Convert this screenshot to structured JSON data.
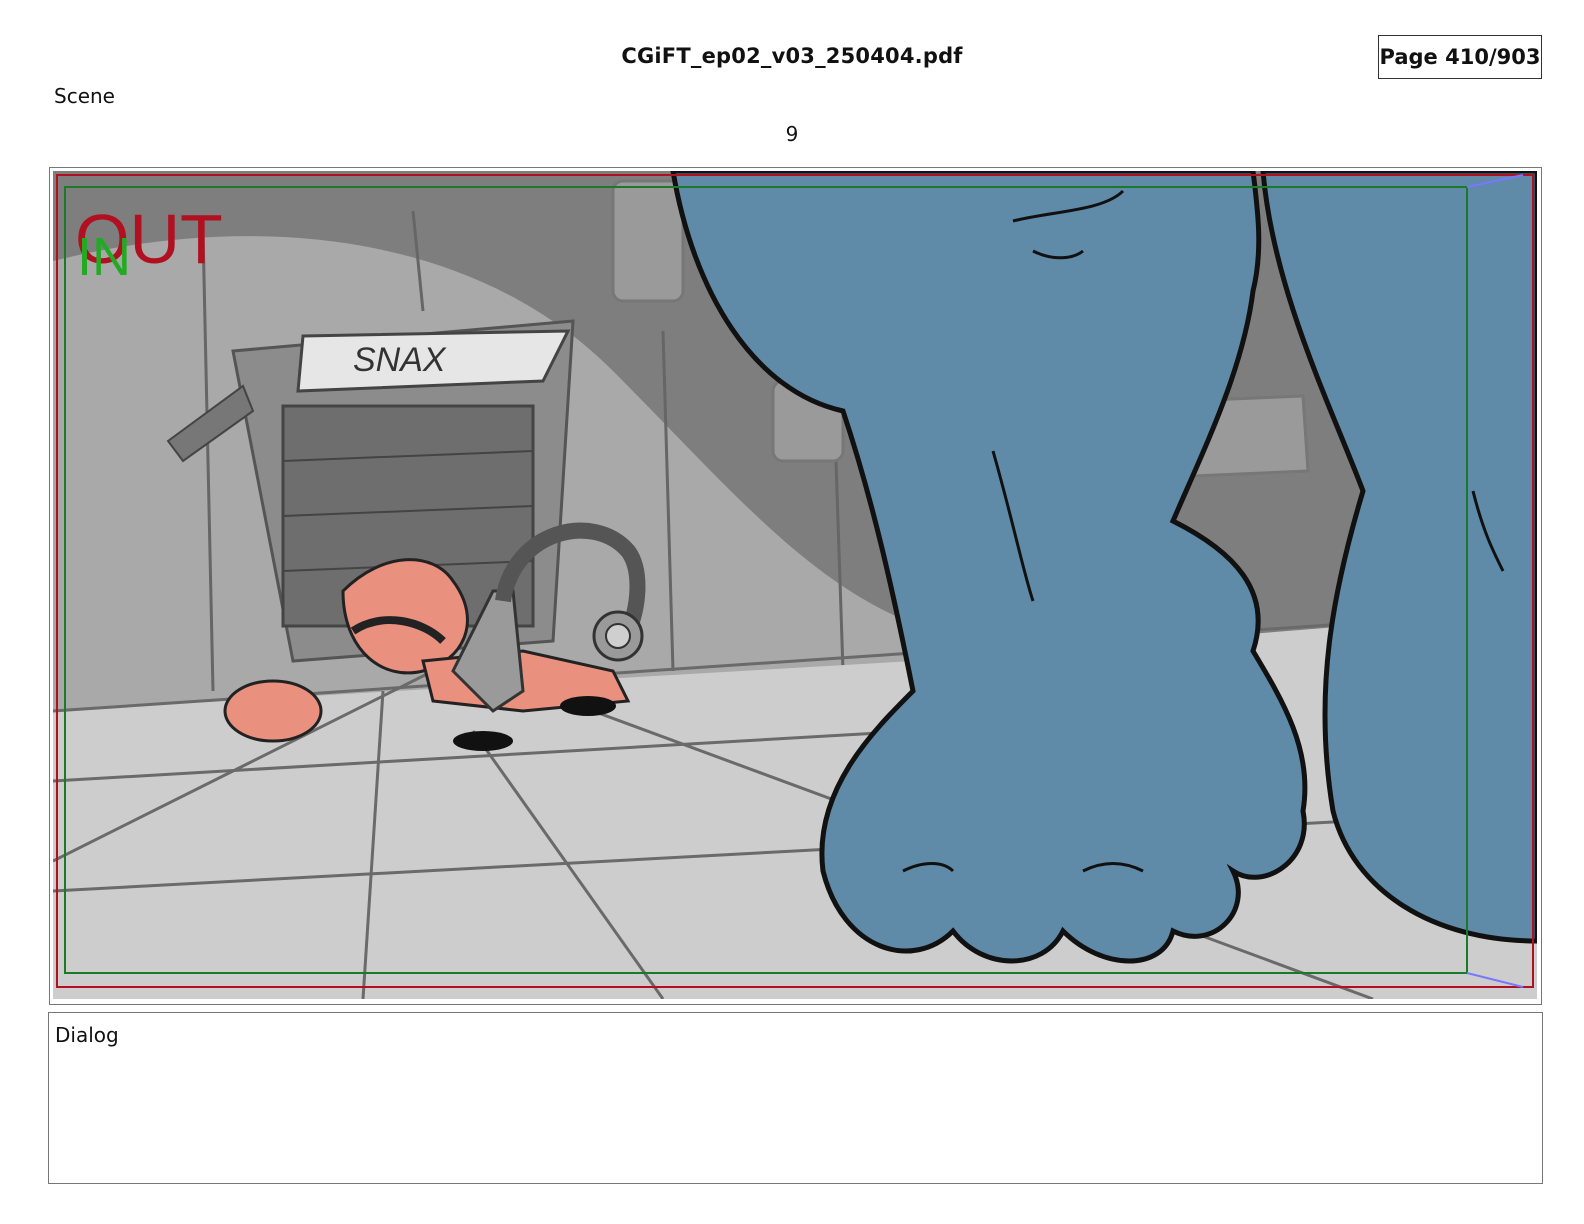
{
  "document": {
    "filename": "CGiFT_ep02_v03_250404.pdf",
    "page_indicator": "Page 410/903"
  },
  "scene": {
    "label": "Scene",
    "number": "9"
  },
  "panel": {
    "overlay_out": "OUT",
    "overlay_in": "IN",
    "sign_text": "SNAX",
    "colors": {
      "wall": "#8a8a8a",
      "floor": "#cfcfcf",
      "monster": "#5f8aa8",
      "character": "#e9907f",
      "frame_red": "#b01020",
      "frame_green": "#1a7a2a",
      "in_green": "#22aa22"
    }
  },
  "dialog": {
    "label": "Dialog",
    "text": ""
  }
}
